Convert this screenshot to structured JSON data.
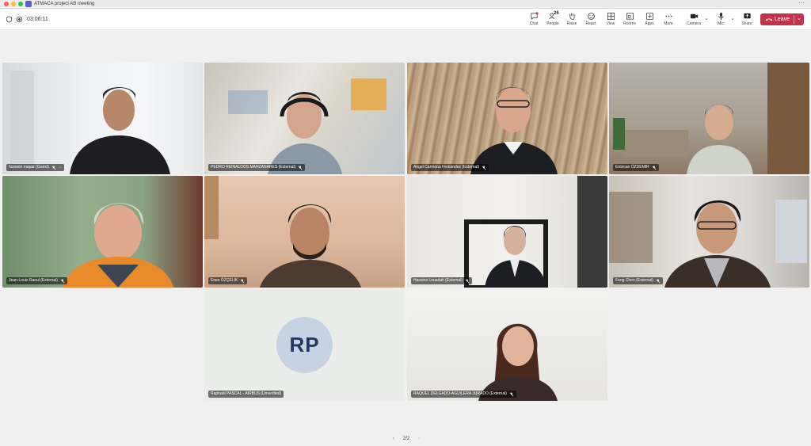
{
  "window": {
    "title": "ATMACA project AB meeting",
    "more_icon": "more-horizontal-icon"
  },
  "toolbar": {
    "timer": "03:06:11",
    "chat_label": "Chat",
    "people_label": "People",
    "people_count": "26",
    "raise_label": "Raise",
    "react_label": "React",
    "view_label": "View",
    "rooms_label": "Rooms",
    "apps_label": "Apps",
    "more_label": "More",
    "camera_label": "Camera",
    "mic_label": "Mic",
    "share_label": "Share",
    "leave_label": "Leave",
    "leave_color": "#c4314b",
    "accent": "#5b5fc7"
  },
  "participants": [
    {
      "name": "hossein mapar (Guest)",
      "muted": true,
      "more": "..."
    },
    {
      "name": "PEDRO REINALDOS MANZANARES (External)",
      "muted": true
    },
    {
      "name": "Angel Carmona Fernández (External)",
      "muted": true
    },
    {
      "name": "Emircan ÖZDEMIR",
      "muted": true
    },
    {
      "name": "Jean-Louis Raoul (External)",
      "muted": true
    },
    {
      "name": "Enes ÖZÇELIK",
      "muted": true
    },
    {
      "name": "Hassina Louadah (External)",
      "muted": true
    },
    {
      "name": "Feng Chen (External)",
      "muted": true
    },
    {
      "name": "Raphaël PASCAL - AIRBUS (Unverified)",
      "muted": true,
      "initials": "RP"
    },
    {
      "name": "RAQUEL DELGADO-AGUILERA JURADO (External)",
      "muted": true
    }
  ],
  "pager": {
    "label": "2/2"
  }
}
